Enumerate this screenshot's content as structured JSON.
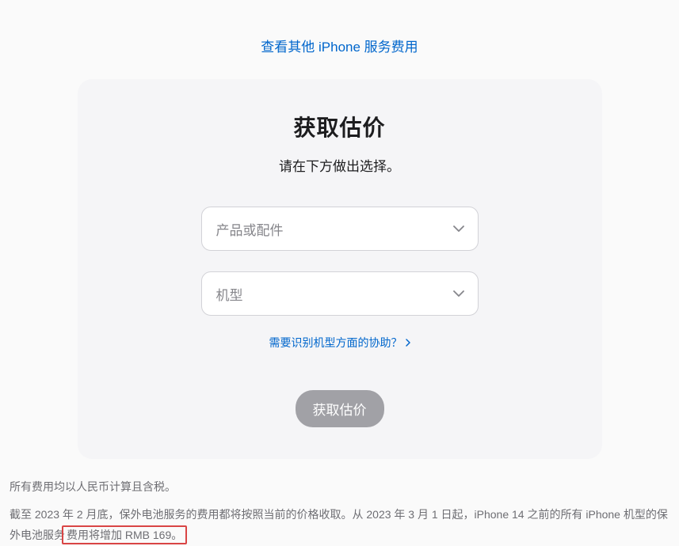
{
  "topLink": {
    "label": "查看其他 iPhone 服务费用"
  },
  "card": {
    "title": "获取估价",
    "subtitle": "请在下方做出选择。",
    "productSelect": {
      "placeholder": "产品或配件"
    },
    "modelSelect": {
      "placeholder": "机型"
    },
    "helpLink": {
      "label": "需要识别机型方面的协助？"
    },
    "button": {
      "label": "获取估价"
    }
  },
  "footnotes": {
    "line1": "所有费用均以人民币计算且含税。",
    "line2_part1": "截至 2023 年 2 月底，保外电池服务的费用都将按照当前的价格收取。从 2023 年 3 月 1 日起，iPhone 14 之前的所有 iPhone 机型的保外电池服务",
    "line2_highlight": "费用将增加 RMB 169。"
  }
}
